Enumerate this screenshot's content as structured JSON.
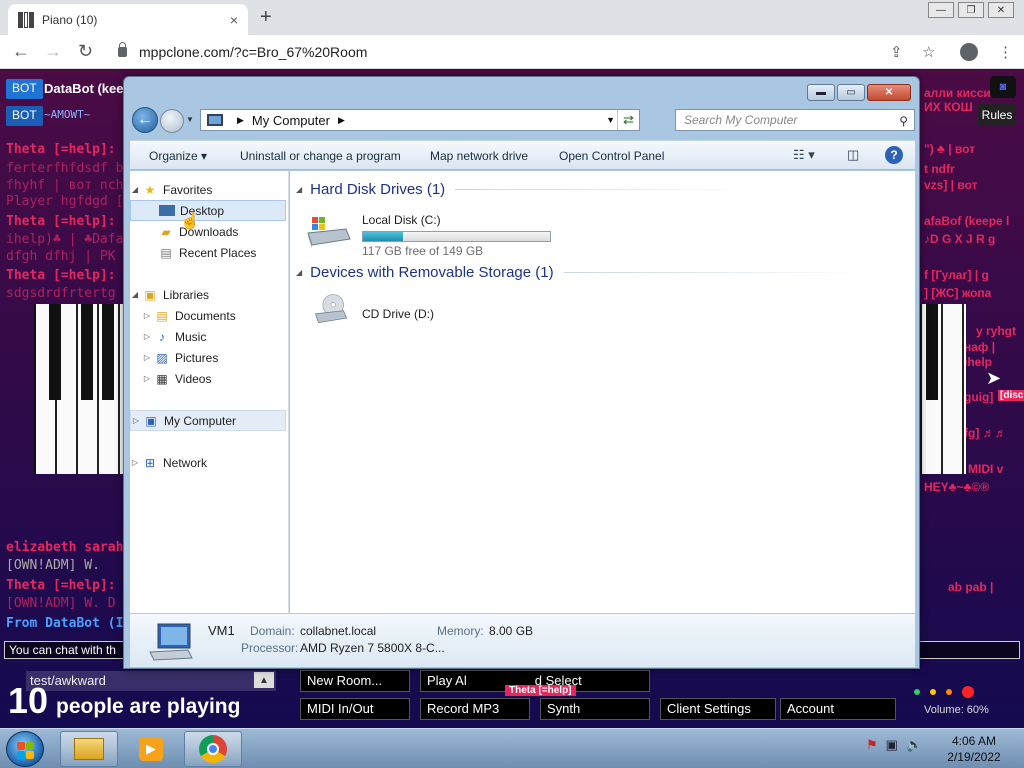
{
  "browser": {
    "tab_title": "Piano (10)",
    "tab_close": "×",
    "new_tab": "+",
    "window_buttons": [
      "—",
      "❐",
      "✕"
    ],
    "url": "mppclone.com/?c=Bro_67%20Room"
  },
  "page": {
    "bot_badge": "BOT",
    "top_bot_name": "DataBot (kee",
    "second_bot_text": "~AMOWT~",
    "chat_lines_left": [
      "Theta [=help]:",
      "ferterfhfdsdf bhdf",
      "fhyhf | вот nchhfc",
      "Player hgfdgd [gd",
      "Theta [=help]:",
      "ihelp)♣ | ♣DafaB",
      "dfgh dfhj | PK XD",
      "Theta [=help]:",
      "sdgsdrdfrtertg | D",
      "elizabeth sarah:",
      "[OWN!ADM] W.",
      "Theta [=help]:",
      "[OWN!ADM] W. D"
    ],
    "chat_from": "From  DataBot (I",
    "chat_lines_right": [
      "алли кисси",
      "ИХ КОШ",
      "\") ♣ | вот",
      "t ndfr",
      "vzs] | вот",
      "afaBof (keepe l",
      "♪D G X J R g",
      "f [Гулаг] | g",
      "] [ЖС] жопа",
      "y ryhgt",
      "наф |",
      "ihelp",
      "guig]",
      "fg] ♬♬",
      "MIDI v",
      "HEY♣~♣©®",
      "ab pab |"
    ],
    "disc_tag": "[disc",
    "rules": "Rules",
    "chat_input_text": "You can chat with th",
    "room_name": "test/awkward",
    "players_count": "10",
    "players_text": "people are playing",
    "buttons": {
      "new_room": "New Room...",
      "play_alone": "Play Al",
      "select": "d Select",
      "midi": "MIDI In/Out",
      "record": "Record MP3",
      "synth": "Synth",
      "client_settings": "Client Settings",
      "account": "Account"
    },
    "cursor_label": "Theta [=help]",
    "volume": "Volume: 60%"
  },
  "explorer": {
    "address": "My Computer",
    "search_placeholder": "Search My Computer",
    "commands": {
      "organize": "Organize ▾",
      "uninstall": "Uninstall or change a program",
      "map_drive": "Map network drive",
      "control_panel": "Open Control Panel"
    },
    "nav": {
      "favorites": "Favorites",
      "desktop": "Desktop",
      "downloads": "Downloads",
      "recent": "Recent Places",
      "libraries": "Libraries",
      "documents": "Documents",
      "music": "Music",
      "pictures": "Pictures",
      "videos": "Videos",
      "my_computer": "My Computer",
      "network": "Network"
    },
    "groups": {
      "hdd_header": "Hard Disk Drives (1)",
      "removable_header": "Devices with Removable Storage (1)"
    },
    "drives": {
      "c_name": "Local Disk (C:)",
      "c_free": "117 GB free of 149 GB",
      "c_used_fraction": 0.215,
      "d_name": "CD Drive (D:)"
    },
    "details": {
      "computer_name": "VM1",
      "domain_label": "Domain:",
      "domain_value": "collabnet.local",
      "memory_label": "Memory:",
      "memory_value": "8.00 GB",
      "processor_label": "Processor:",
      "processor_value": "AMD Ryzen 7 5800X 8-C..."
    }
  },
  "taskbar": {
    "time": "4:06 AM",
    "date": "2/19/2022"
  }
}
